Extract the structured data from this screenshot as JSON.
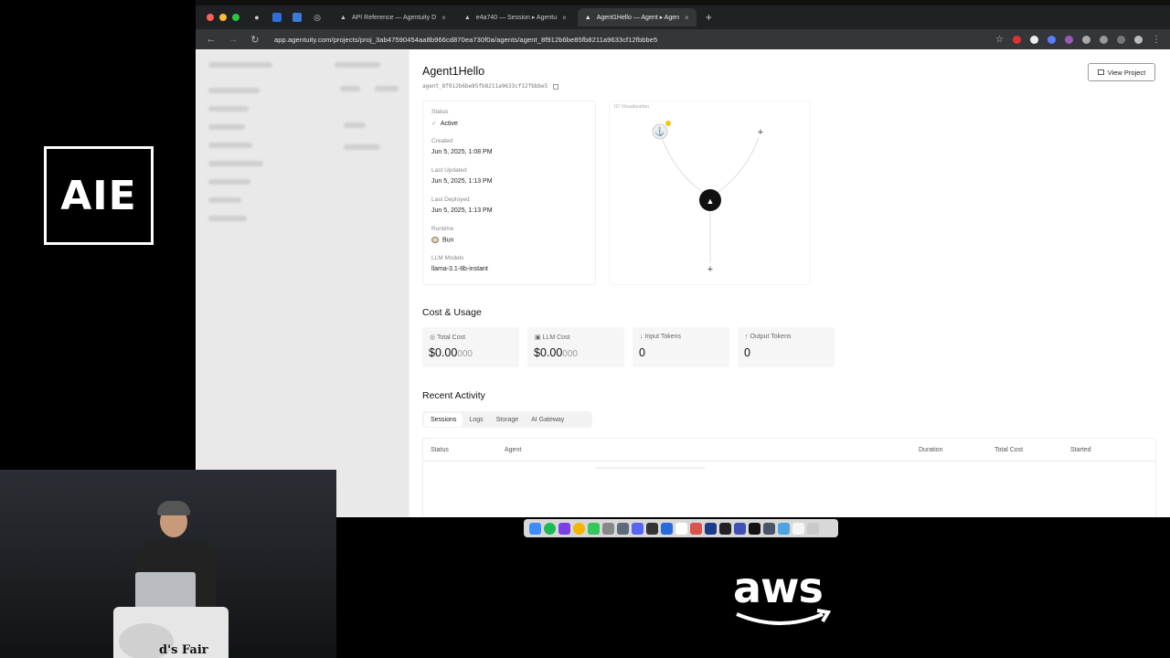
{
  "overlay": {
    "logo_text": "AIE",
    "sponsor": "aws",
    "podium_text": "d's Fair"
  },
  "browser": {
    "tabs": [
      {
        "label": "API Reference — Agentuity D",
        "active": false
      },
      {
        "label": "e4a740 — Session ▸ Agentu",
        "active": false
      },
      {
        "label": "Agent1Hello — Agent ▸ Agen",
        "active": true
      }
    ],
    "url": "app.agentuity.com/projects/proj_3ab47590454aa8b966cd870ea730f0a/agents/agent_8f912b6be85fb8211a9633cf12fbbbe5"
  },
  "agent": {
    "name": "Agent1Hello",
    "id": "agent_8f912b6be85fb8211a9633cf12fbbbe5",
    "view_project_label": "View Project",
    "status_label": "Status",
    "status_value": "Active",
    "created_label": "Created",
    "created_value": "Jun 5, 2025, 1:08 PM",
    "updated_label": "Last Updated",
    "updated_value": "Jun 5, 2025, 1:13 PM",
    "deployed_label": "Last Deployed",
    "deployed_value": "Jun 5, 2025, 1:13 PM",
    "runtime_label": "Runtime",
    "runtime_value": "Bun",
    "llm_label": "LLM Models",
    "llm_value": "llama-3.1-8b-instant",
    "io_label": "IO Visualization"
  },
  "cost": {
    "title": "Cost & Usage",
    "stats": [
      {
        "label": "Total Cost",
        "value": "$0.00",
        "suffix": "000"
      },
      {
        "label": "LLM Cost",
        "value": "$0.00",
        "suffix": "000"
      },
      {
        "label": "Input Tokens",
        "value": "0",
        "suffix": ""
      },
      {
        "label": "Output Tokens",
        "value": "0",
        "suffix": ""
      }
    ]
  },
  "activity": {
    "title": "Recent Activity",
    "tabs": [
      "Sessions",
      "Logs",
      "Storage",
      "AI Gateway"
    ],
    "columns": [
      "Status",
      "Agent",
      "Duration",
      "Total Cost",
      "Started"
    ]
  },
  "colors": {
    "accent_dot": "#f5c518",
    "node_dark": "#111111"
  }
}
